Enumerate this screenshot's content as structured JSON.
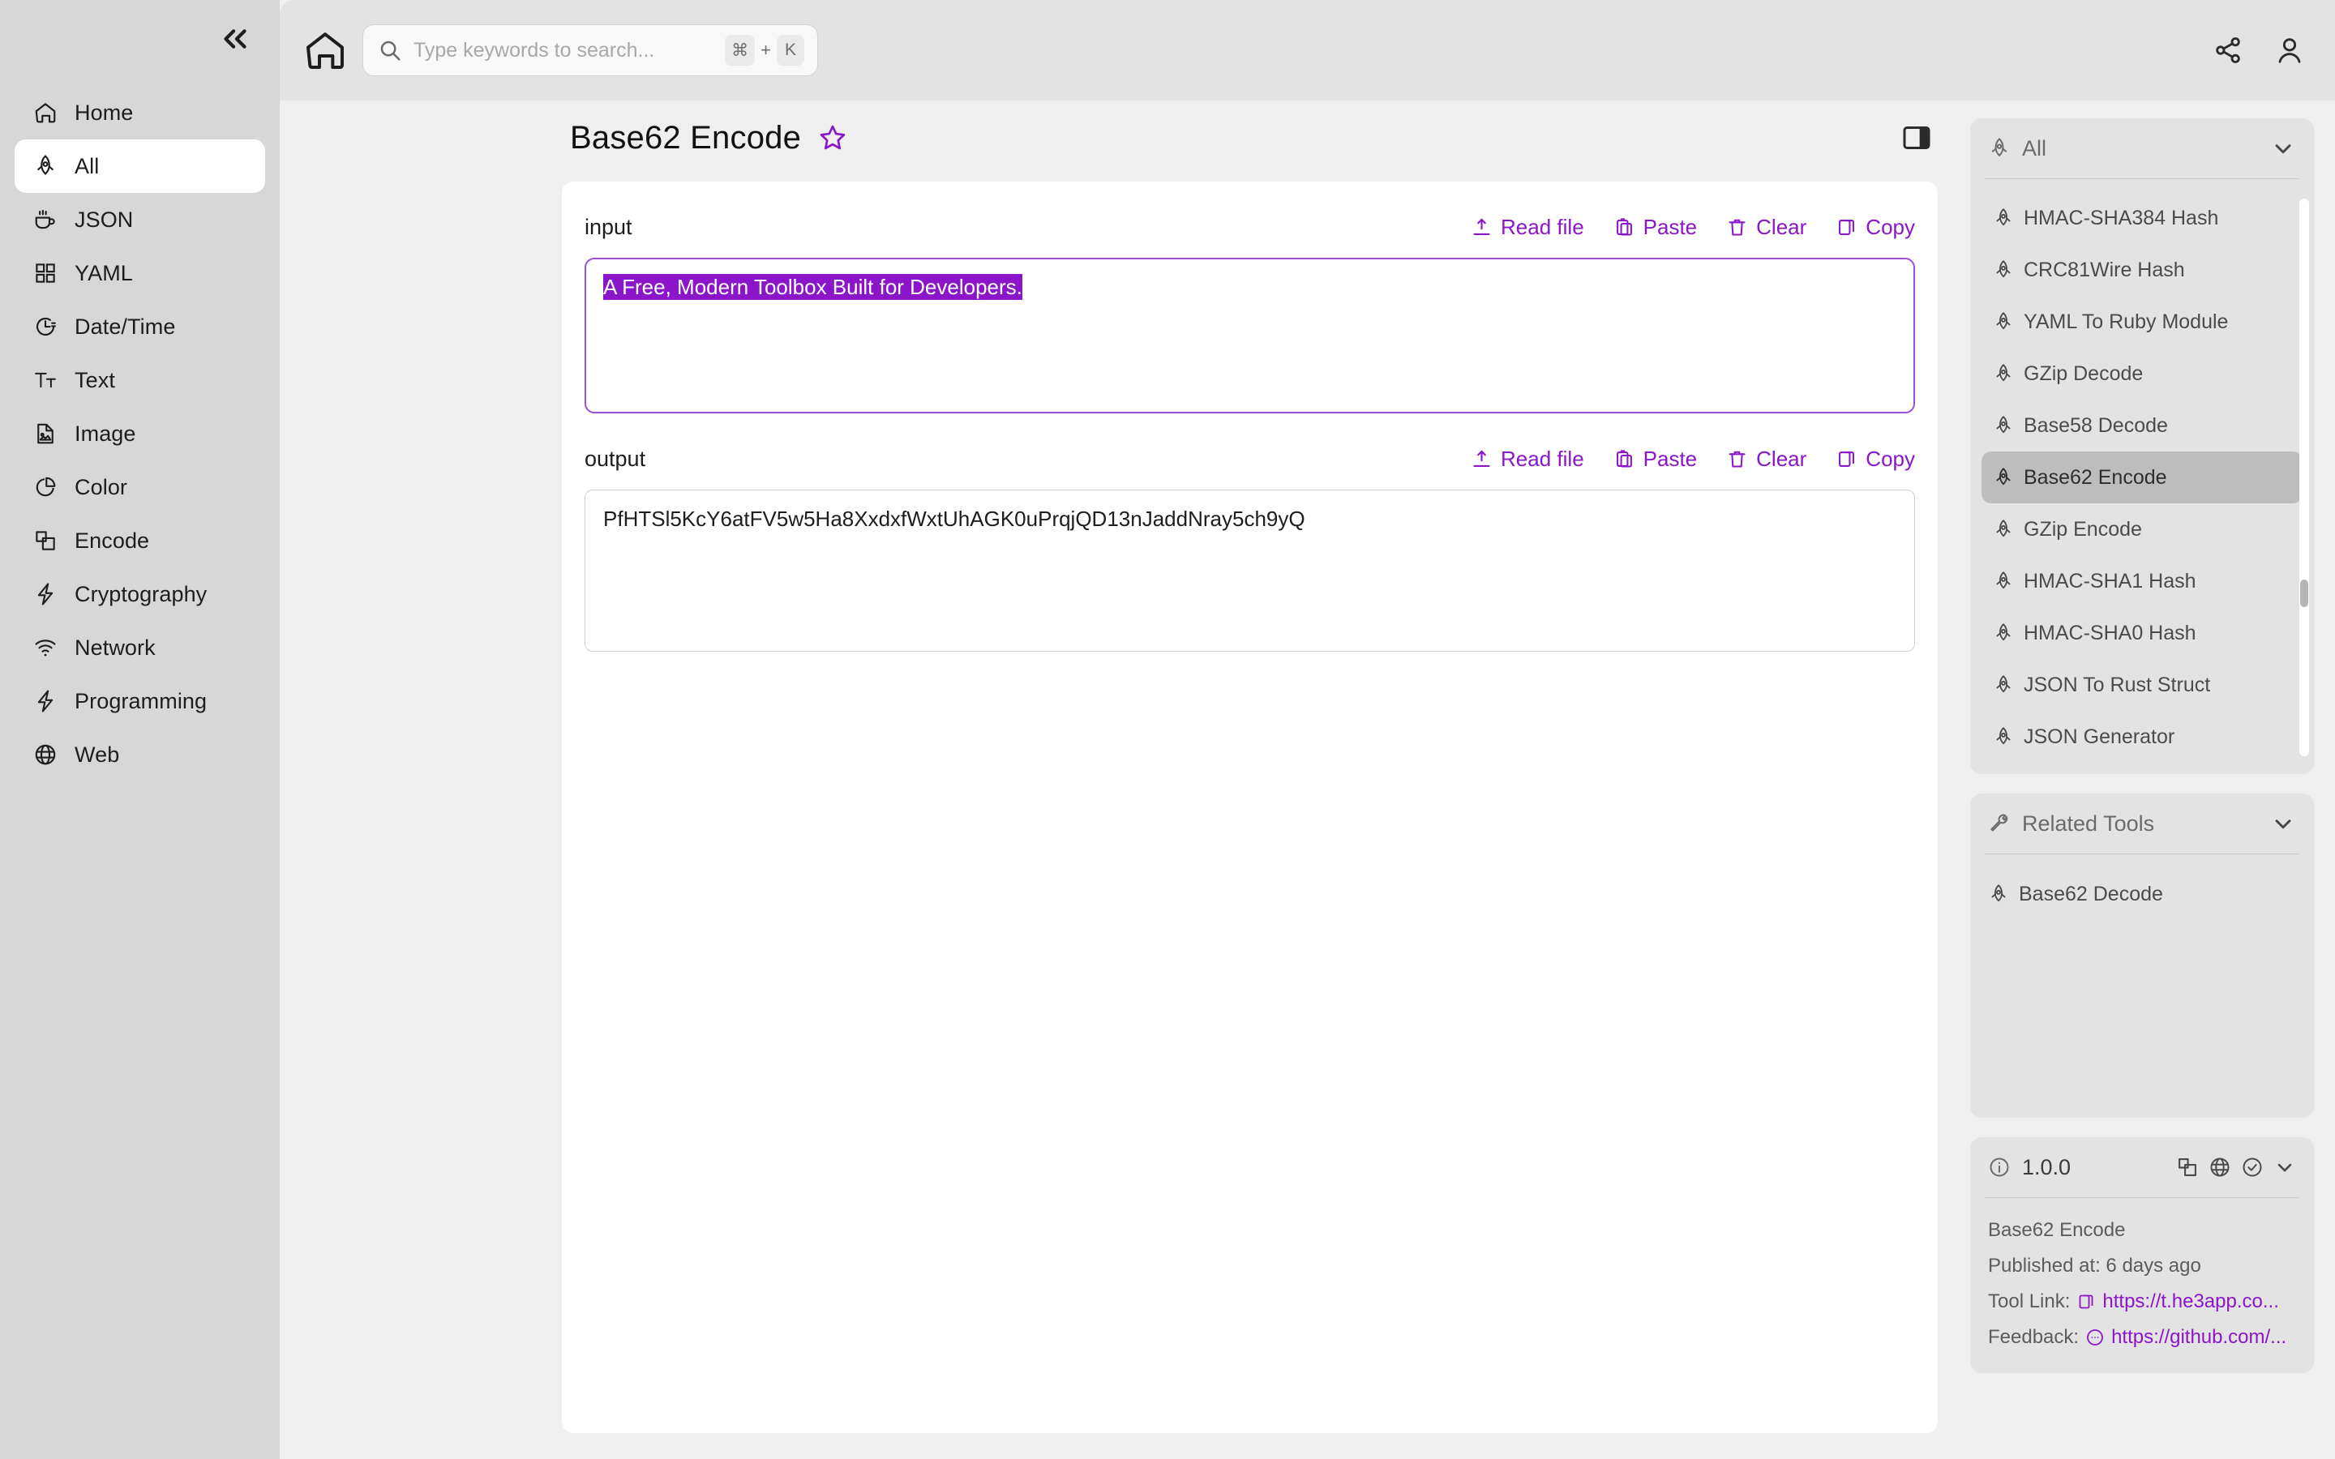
{
  "sidebar": {
    "collapse_icon": "chevrons-left-icon",
    "items": [
      {
        "label": "Home",
        "icon": "house-icon",
        "active": false
      },
      {
        "label": "All",
        "icon": "rocket-icon",
        "active": true
      },
      {
        "label": "JSON",
        "icon": "coffee-icon",
        "active": false
      },
      {
        "label": "YAML",
        "icon": "grid-icon",
        "active": false
      },
      {
        "label": "Date/Time",
        "icon": "clock-icon",
        "active": false
      },
      {
        "label": "Text",
        "icon": "text-size-icon",
        "active": false
      },
      {
        "label": "Image",
        "icon": "image-file-icon",
        "active": false
      },
      {
        "label": "Color",
        "icon": "pie-chart-icon",
        "active": false
      },
      {
        "label": "Encode",
        "icon": "copy-layers-icon",
        "active": false
      },
      {
        "label": "Cryptography",
        "icon": "bolt-icon",
        "active": false
      },
      {
        "label": "Network",
        "icon": "wifi-icon",
        "active": false
      },
      {
        "label": "Programming",
        "icon": "bolt-icon",
        "active": false
      },
      {
        "label": "Web",
        "icon": "globe-icon",
        "active": false
      }
    ]
  },
  "topbar": {
    "home_icon": "home-icon",
    "search": {
      "placeholder": "Type keywords to search...",
      "value": "",
      "icon": "search-icon",
      "shortcut_key": "⌘",
      "shortcut_plus": "+",
      "shortcut_letter": "K"
    },
    "share_icon": "share-icon",
    "account_icon": "user-icon"
  },
  "header": {
    "title": "Base62 Encode",
    "favorite_icon": "star-outline-icon",
    "panel_toggle_icon": "right-panel-icon"
  },
  "workspace": {
    "input": {
      "label": "input",
      "value": "A Free, Modern Toolbox Built for Developers.",
      "selected": true,
      "actions": [
        {
          "label": "Read file",
          "icon": "upload-icon"
        },
        {
          "label": "Paste",
          "icon": "clipboard-icon"
        },
        {
          "label": "Clear",
          "icon": "trash-icon"
        },
        {
          "label": "Copy",
          "icon": "copy-icon"
        }
      ]
    },
    "output": {
      "label": "output",
      "value": "PfHTSl5KcY6atFV5w5Ha8XxdxfWxtUhAGK0uPrqjQD13nJaddNray5ch9yQ",
      "actions": [
        {
          "label": "Read file",
          "icon": "upload-icon"
        },
        {
          "label": "Paste",
          "icon": "clipboard-icon"
        },
        {
          "label": "Clear",
          "icon": "trash-icon"
        },
        {
          "label": "Copy",
          "icon": "copy-icon"
        }
      ]
    }
  },
  "rail": {
    "tools_card": {
      "title": "All",
      "title_icon": "rocket-icon",
      "chevron_icon": "chevron-down-icon",
      "items": [
        {
          "label": "HMAC-SHA384 Hash",
          "selected": false
        },
        {
          "label": "CRC81Wire Hash",
          "selected": false
        },
        {
          "label": "YAML To Ruby Module",
          "selected": false
        },
        {
          "label": "GZip Decode",
          "selected": false
        },
        {
          "label": "Base58 Decode",
          "selected": false
        },
        {
          "label": "Base62 Encode",
          "selected": true
        },
        {
          "label": "GZip Encode",
          "selected": false
        },
        {
          "label": "HMAC-SHA1 Hash",
          "selected": false
        },
        {
          "label": "HMAC-SHA0 Hash",
          "selected": false
        },
        {
          "label": "JSON To Rust Struct",
          "selected": false
        },
        {
          "label": "JSON Generator",
          "selected": false
        }
      ]
    },
    "related_card": {
      "title": "Related Tools",
      "title_icon": "wrench-icon",
      "chevron_icon": "chevron-down-icon",
      "items": [
        {
          "label": "Base62 Decode"
        }
      ]
    },
    "version_card": {
      "version": "1.0.0",
      "info_icon": "info-circle-icon",
      "head_icons": [
        "copy-layers-icon",
        "globe-icon",
        "check-circle-icon",
        "chevron-down-icon"
      ],
      "tool_name": "Base62 Encode",
      "published_label": "Published at: 6 days ago",
      "tool_link_label": "Tool Link:",
      "tool_link_value": "https://t.he3app.co...",
      "tool_link_icon": "copy-icon",
      "feedback_label": "Feedback:",
      "feedback_value": "https://github.com/...",
      "feedback_icon": "chat-icon"
    }
  },
  "colors": {
    "accent": "#8b16c9",
    "sidebar_bg": "#d7d7d7",
    "main_bg": "#efefef",
    "card_bg": "#e3e3e3",
    "selection_bg": "#8b16c9"
  }
}
